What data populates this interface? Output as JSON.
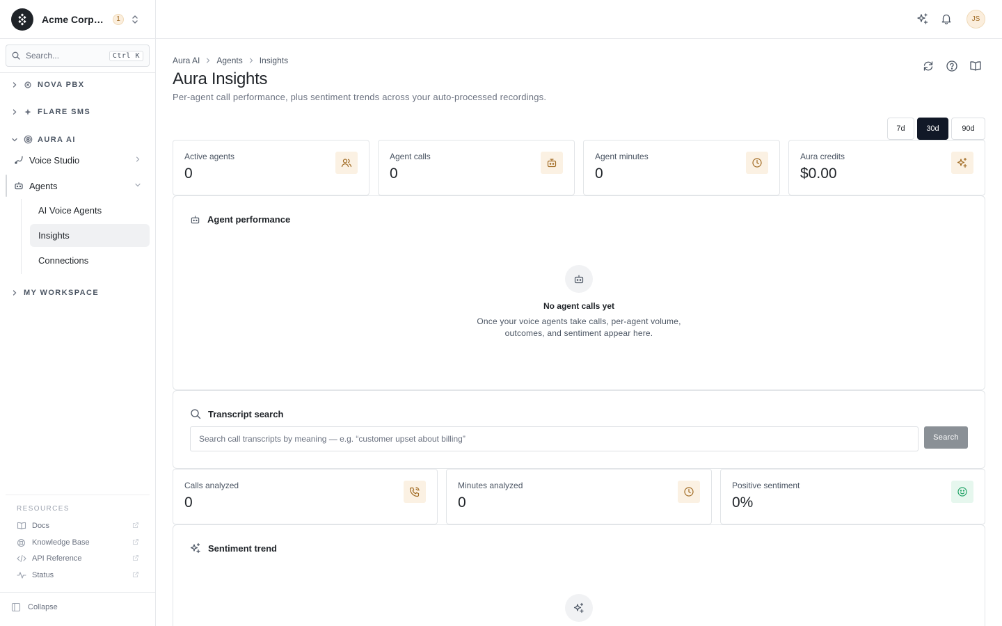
{
  "org": {
    "name": "Acme Corporation",
    "badge": "1"
  },
  "search": {
    "placeholder": "Search...",
    "shortcut": "Ctrl K"
  },
  "nav": {
    "sections": [
      {
        "label": "NOVA PBX"
      },
      {
        "label": "FLARE SMS"
      },
      {
        "label": "AURA AI"
      },
      {
        "label": "MY WORKSPACE"
      }
    ],
    "voice_studio": "Voice Studio",
    "agents": "Agents",
    "sub_items": [
      {
        "label": "AI Voice Agents"
      },
      {
        "label": "Insights"
      },
      {
        "label": "Connections"
      }
    ]
  },
  "resources": {
    "title": "RESOURCES",
    "items": [
      {
        "label": "Docs",
        "icon": "book-icon"
      },
      {
        "label": "Knowledge Base",
        "icon": "lifebuoy-icon"
      },
      {
        "label": "API Reference",
        "icon": "code-icon"
      },
      {
        "label": "Status",
        "icon": "activity-icon"
      }
    ],
    "collapse": "Collapse"
  },
  "user": {
    "initials": "JS"
  },
  "breadcrumb": [
    "Aura AI",
    "Agents",
    "Insights"
  ],
  "page": {
    "title": "Aura Insights",
    "subtitle": "Per-agent call performance, plus sentiment trends across your auto-processed recordings."
  },
  "ranges": [
    {
      "label": "7d",
      "active": false
    },
    {
      "label": "30d",
      "active": true
    },
    {
      "label": "90d",
      "active": false
    }
  ],
  "stats": [
    {
      "label": "Active agents",
      "value": "0",
      "icon": "users-icon"
    },
    {
      "label": "Agent calls",
      "value": "0",
      "icon": "bot-icon"
    },
    {
      "label": "Agent minutes",
      "value": "0",
      "icon": "clock-icon"
    },
    {
      "label": "Aura credits",
      "value": "$0.00",
      "icon": "sparkles-icon"
    }
  ],
  "agent_performance": {
    "title": "Agent performance",
    "empty_title": "No agent calls yet",
    "empty_desc": "Once your voice agents take calls, per-agent volume, outcomes, and sentiment appear here."
  },
  "transcript_search": {
    "title": "Transcript search",
    "placeholder": "Search call transcripts by meaning — e.g. “customer upset about billing”",
    "button": "Search"
  },
  "analysis_stats": [
    {
      "label": "Calls analyzed",
      "value": "0",
      "icon": "phone-icon"
    },
    {
      "label": "Minutes analyzed",
      "value": "0",
      "icon": "clock-icon"
    },
    {
      "label": "Positive sentiment",
      "value": "0%",
      "icon": "smile-icon",
      "accent": "#21a366"
    }
  ],
  "sentiment_trend": {
    "title": "Sentiment trend"
  },
  "colors": {
    "accent": "#a06a22",
    "accent_bg": "#fbf1e3",
    "primary": "#111827",
    "positive": "#21a366"
  }
}
